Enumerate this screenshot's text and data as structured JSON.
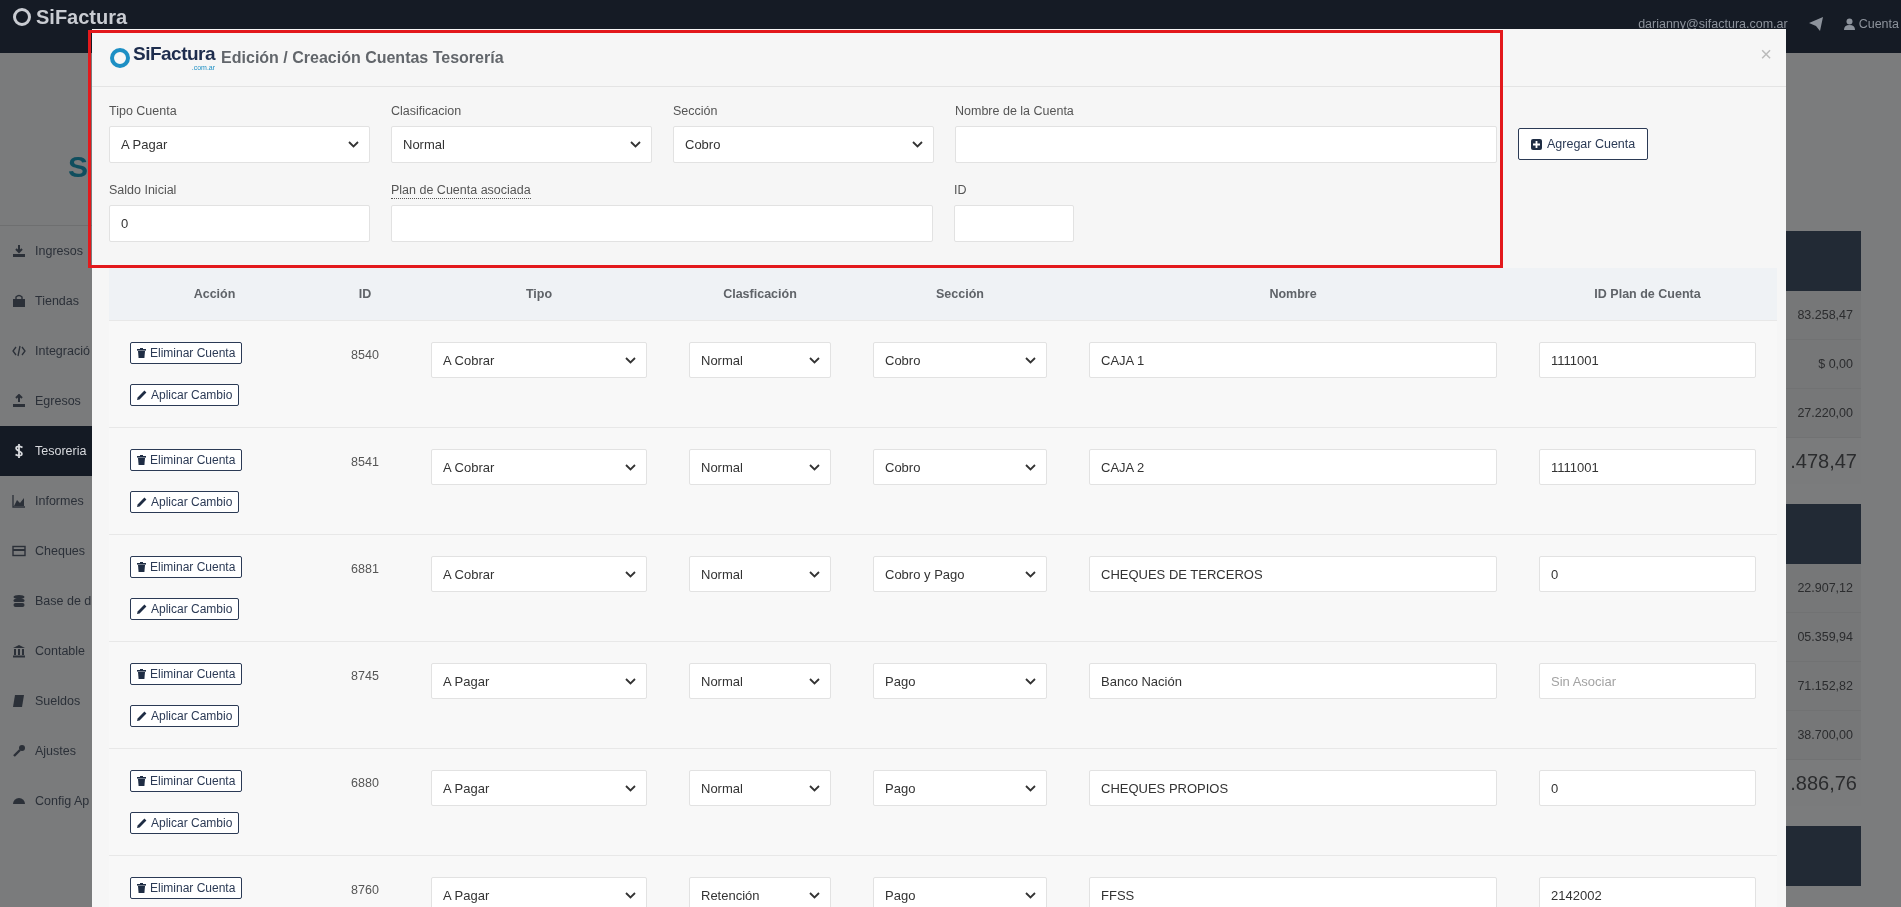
{
  "navbar": {
    "logo": "SiFactura",
    "email": "darianny@sifactura.com.ar",
    "account": "Cuenta"
  },
  "sidebar": {
    "heading": "S",
    "items": [
      {
        "label": "Ingresos",
        "selected": false
      },
      {
        "label": "Tiendas",
        "selected": false
      },
      {
        "label": "Integració",
        "selected": false
      },
      {
        "label": "Egresos",
        "selected": false
      },
      {
        "label": "Tesoreria",
        "selected": true
      },
      {
        "label": "Informes",
        "selected": false
      },
      {
        "label": "Cheques",
        "selected": false
      },
      {
        "label": "Base de d",
        "selected": false
      },
      {
        "label": "Contable",
        "selected": false
      },
      {
        "label": "Sueldos",
        "selected": false
      },
      {
        "label": "Ajustes",
        "selected": false
      },
      {
        "label": "Config Ap",
        "selected": false
      }
    ]
  },
  "background_cards": [
    {
      "rows": [
        "83.258,47",
        "$ 0,00",
        "27.220,00"
      ],
      "total": ".478,47"
    },
    {
      "rows": [
        "22.907,12",
        "05.359,94",
        "71.152,82",
        "38.700,00"
      ],
      "total": ".886,76"
    }
  ],
  "modal": {
    "logo": "SiFactura",
    "logo_suffix": ".com.ar",
    "title": "Edición / Creación Cuentas Tesorería",
    "close": "×",
    "form_rows": [
      [
        {
          "kind": "select",
          "label": "Tipo Cuenta",
          "value": "A Pagar",
          "tooltip": false
        },
        {
          "kind": "select",
          "label": "Clasificacion",
          "value": "Normal",
          "tooltip": false
        },
        {
          "kind": "select",
          "label": "Sección",
          "value": "Cobro",
          "tooltip": false
        },
        {
          "kind": "input",
          "label": "Nombre de la Cuenta",
          "tooltip": false
        }
      ],
      [
        {
          "kind": "input",
          "label": "Saldo Inicial",
          "value": "0",
          "tooltip": false
        },
        {
          "kind": "input",
          "label": "Plan de Cuenta asociada",
          "tooltip": true
        },
        {
          "kind": "input",
          "label": "ID",
          "tooltip": false
        }
      ]
    ],
    "add_button": "Agregar Cuenta"
  },
  "table": {
    "columns": [
      "Acción",
      "ID",
      "Tipo",
      "Clasficación",
      "Sección",
      "Nombre",
      "ID Plan de Cuenta"
    ],
    "rows": [
      {
        "id": "8540",
        "tipo": "A Cobrar",
        "clasificacion": "Normal",
        "seccion": "Cobro",
        "nombre": "CAJA 1",
        "plan": "1111001",
        "actions": [
          {
            "kind": "delete",
            "label": "Eliminar Cuenta"
          },
          {
            "kind": "edit",
            "label": "Aplicar Cambio"
          }
        ]
      },
      {
        "id": "8541",
        "tipo": "A Cobrar",
        "clasificacion": "Normal",
        "seccion": "Cobro",
        "nombre": "CAJA 2",
        "plan": "1111001",
        "actions": [
          {
            "kind": "delete",
            "label": "Eliminar Cuenta"
          },
          {
            "kind": "edit",
            "label": "Aplicar Cambio"
          }
        ]
      },
      {
        "id": "6881",
        "tipo": "A Cobrar",
        "clasificacion": "Normal",
        "seccion": "Cobro y Pago",
        "nombre": "CHEQUES DE TERCEROS",
        "plan": "0",
        "actions": [
          {
            "kind": "delete",
            "label": "Eliminar Cuenta"
          },
          {
            "kind": "edit",
            "label": "Aplicar Cambio"
          }
        ]
      },
      {
        "id": "8745",
        "tipo": "A Pagar",
        "clasificacion": "Normal",
        "seccion": "Pago",
        "nombre": "Banco Nación",
        "plan_placeholder": "Sin Asociar",
        "actions": [
          {
            "kind": "delete",
            "label": "Eliminar Cuenta"
          },
          {
            "kind": "edit",
            "label": "Aplicar Cambio"
          }
        ]
      },
      {
        "id": "6880",
        "tipo": "A Pagar",
        "clasificacion": "Normal",
        "seccion": "Pago",
        "nombre": "CHEQUES PROPIOS",
        "plan": "0",
        "actions": [
          {
            "kind": "delete",
            "label": "Eliminar Cuenta"
          },
          {
            "kind": "edit",
            "label": "Aplicar Cambio"
          }
        ]
      },
      {
        "id": "8760",
        "tipo": "A Pagar",
        "clasificacion": "Retención",
        "seccion": "Pago",
        "nombre": "FFSS",
        "plan": "2142002",
        "actions": [
          {
            "kind": "delete",
            "label": "Eliminar Cuenta"
          }
        ]
      }
    ]
  }
}
